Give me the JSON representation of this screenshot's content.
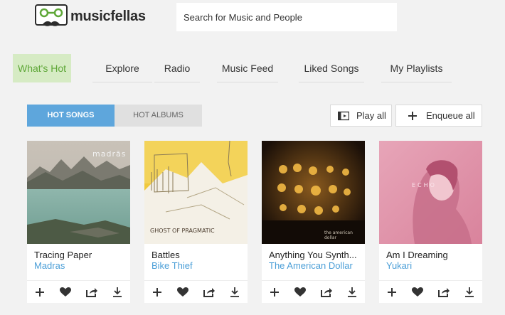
{
  "header": {
    "brand": "musicfellas",
    "search_placeholder": "Search for Music and People"
  },
  "nav": [
    {
      "label": "What's Hot",
      "active": true
    },
    {
      "label": "Explore"
    },
    {
      "label": "Radio"
    },
    {
      "label": "Music Feed"
    },
    {
      "label": "Liked Songs"
    },
    {
      "label": "My Playlists"
    }
  ],
  "tabs": {
    "hot_songs": "HOT SONGS",
    "hot_albums": "HOT ALBUMS"
  },
  "buttons": {
    "play_all": "Play all",
    "enqueue_all": "Enqueue all"
  },
  "songs": [
    {
      "title": "Tracing Paper",
      "artist": "Madras",
      "art_text": "madrãs"
    },
    {
      "title": "Battles",
      "artist": "Bike Thief",
      "art_text": "GHOST OF PRAGMATIC"
    },
    {
      "title": "Anything You Synth...",
      "artist": "The American Dollar",
      "art_text": "the american dollar"
    },
    {
      "title": "Am I Dreaming",
      "artist": "Yukari",
      "art_text": "ECHO"
    }
  ],
  "icons": {
    "add": "plus-icon",
    "like": "heart-icon",
    "share": "share-icon",
    "download": "download-icon"
  },
  "colors": {
    "accent_blue": "#5ea6dc",
    "active_green_bg": "#d6ebc4",
    "active_green_text": "#5ea737",
    "artist_link": "#4a9ed7"
  }
}
